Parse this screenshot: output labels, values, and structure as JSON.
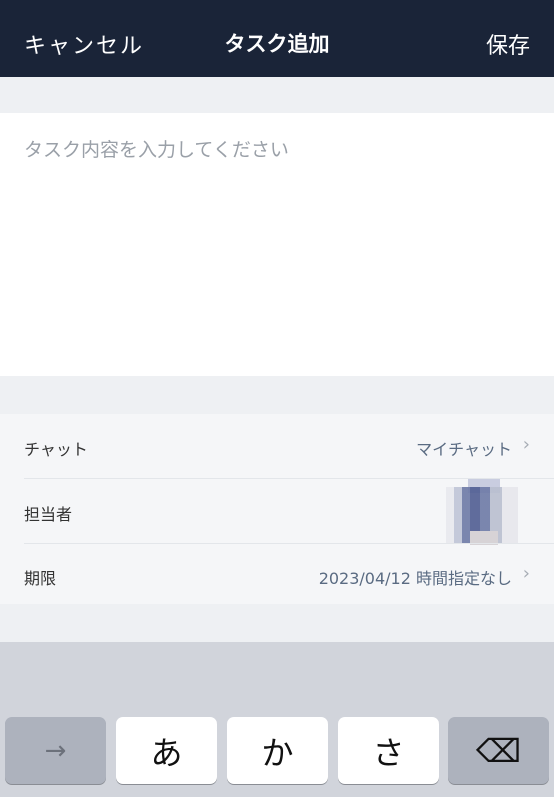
{
  "nav": {
    "cancel_label": "キャンセル",
    "title": "タスク追加",
    "save_label": "保存"
  },
  "task": {
    "placeholder": "タスク内容を入力してください"
  },
  "settings": {
    "chat": {
      "label": "チャット",
      "value": "マイチャット"
    },
    "assignee": {
      "label": "担当者"
    },
    "deadline": {
      "label": "期限",
      "value": "2023/04/12 時間指定なし"
    }
  },
  "keyboard": {
    "keys": {
      "arrow": "→",
      "a": "あ",
      "ka": "か",
      "sa": "さ",
      "delete": "⌫"
    }
  },
  "colors": {
    "navbar": "#1a2438",
    "background": "#eef0f3",
    "value_text": "#5a6b82",
    "keyboard_bg": "#d1d4db"
  }
}
